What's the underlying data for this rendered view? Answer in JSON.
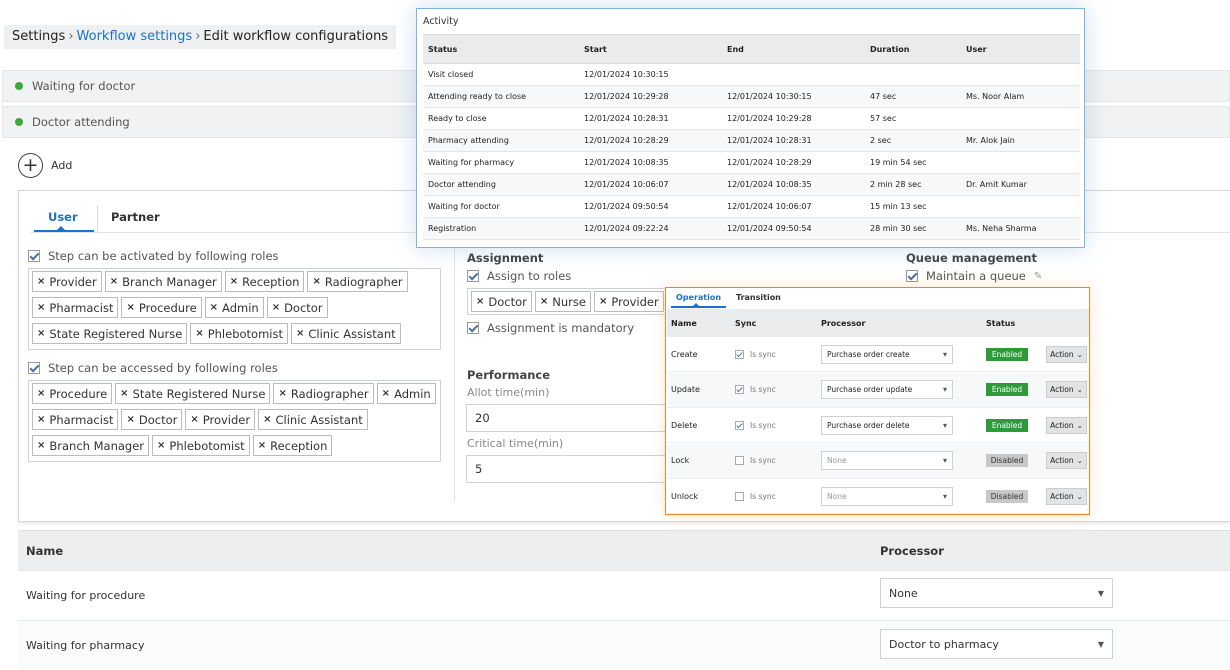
{
  "breadcrumb": {
    "root": "Settings",
    "parent": "Workflow settings",
    "current": "Edit workflow configurations"
  },
  "steps": [
    {
      "label": "Waiting for doctor"
    },
    {
      "label": "Doctor attending"
    }
  ],
  "add_label": "Add",
  "tabs": {
    "user": "User",
    "partner": "Partner"
  },
  "roles": {
    "activated_label": "Step can be activated by following roles",
    "activated_tags": [
      "Provider",
      "Branch Manager",
      "Reception",
      "Radiographer",
      "Pharmacist",
      "Procedure",
      "Admin",
      "Doctor",
      "State Registered Nurse",
      "Phlebotomist",
      "Clinic Assistant"
    ],
    "accessed_label": "Step can be accessed by following roles",
    "accessed_tags": [
      "Procedure",
      "State Registered Nurse",
      "Radiographer",
      "Admin",
      "Pharmacist",
      "Doctor",
      "Provider",
      "Clinic Assistant",
      "Branch Manager",
      "Phlebotomist",
      "Reception"
    ]
  },
  "assignment": {
    "title": "Assignment",
    "assign_to_roles_label": "Assign to roles",
    "tags": [
      "Doctor",
      "Nurse",
      "Provider"
    ],
    "mandatory_label": "Assignment is mandatory"
  },
  "queue": {
    "title": "Queue management",
    "maintain_label": "Maintain a queue"
  },
  "performance": {
    "title": "Performance",
    "allot_label": "Allot time(min)",
    "allot_value": "20",
    "critical_label": "Critical time(min)",
    "critical_value": "5"
  },
  "bottom_table": {
    "name_header": "Name",
    "processor_header": "Processor",
    "rows": [
      {
        "name": "Waiting for procedure",
        "processor": "None"
      },
      {
        "name": "Waiting for pharmacy",
        "processor": "Doctor to pharmacy"
      }
    ]
  },
  "activity": {
    "title": "Activity",
    "headers": {
      "status": "Status",
      "start": "Start",
      "end": "End",
      "duration": "Duration",
      "user": "User"
    },
    "rows": [
      {
        "status": "Visit closed",
        "start": "12/01/2024 10:30:15",
        "end": "",
        "duration": "",
        "user": ""
      },
      {
        "status": "Attending ready to close",
        "start": "12/01/2024 10:29:28",
        "end": "12/01/2024 10:30:15",
        "duration": "47 sec",
        "user": "Ms. Noor Alam"
      },
      {
        "status": "Ready to close",
        "start": "12/01/2024 10:28:31",
        "end": "12/01/2024 10:29:28",
        "duration": "57 sec",
        "user": ""
      },
      {
        "status": "Pharmacy attending",
        "start": "12/01/2024 10:28:29",
        "end": "12/01/2024 10:28:31",
        "duration": "2 sec",
        "user": "Mr. Alok Jain"
      },
      {
        "status": "Waiting for pharmacy",
        "start": "12/01/2024 10:08:35",
        "end": "12/01/2024 10:28:29",
        "duration": "19 min 54 sec",
        "user": ""
      },
      {
        "status": "Doctor attending",
        "start": "12/01/2024 10:06:07",
        "end": "12/01/2024 10:08:35",
        "duration": "2 min 28 sec",
        "user": "Dr. Amit Kumar"
      },
      {
        "status": "Waiting for doctor",
        "start": "12/01/2024 09:50:54",
        "end": "12/01/2024 10:06:07",
        "duration": "15 min 13 sec",
        "user": ""
      },
      {
        "status": "Registration",
        "start": "12/01/2024 09:22:24",
        "end": "12/01/2024 09:50:54",
        "duration": "28 min 30 sec",
        "user": "Ms. Neha Sharma"
      }
    ]
  },
  "operation": {
    "tabs": {
      "operation": "Operation",
      "transition": "Transition"
    },
    "headers": {
      "name": "Name",
      "sync": "Sync",
      "processor": "Processor",
      "status": "Status"
    },
    "sync_label": "Is sync",
    "action_label": "Action",
    "rows": [
      {
        "name": "Create",
        "sync": true,
        "processor": "Purchase order create",
        "status": "Enabled"
      },
      {
        "name": "Update",
        "sync": true,
        "processor": "Purchase order update",
        "status": "Enabled"
      },
      {
        "name": "Delete",
        "sync": true,
        "processor": "Purchase order delete",
        "status": "Enabled"
      },
      {
        "name": "Lock",
        "sync": false,
        "processor": "None",
        "status": "Disabled"
      },
      {
        "name": "Unlock",
        "sync": false,
        "processor": "None",
        "status": "Disabled"
      }
    ]
  }
}
